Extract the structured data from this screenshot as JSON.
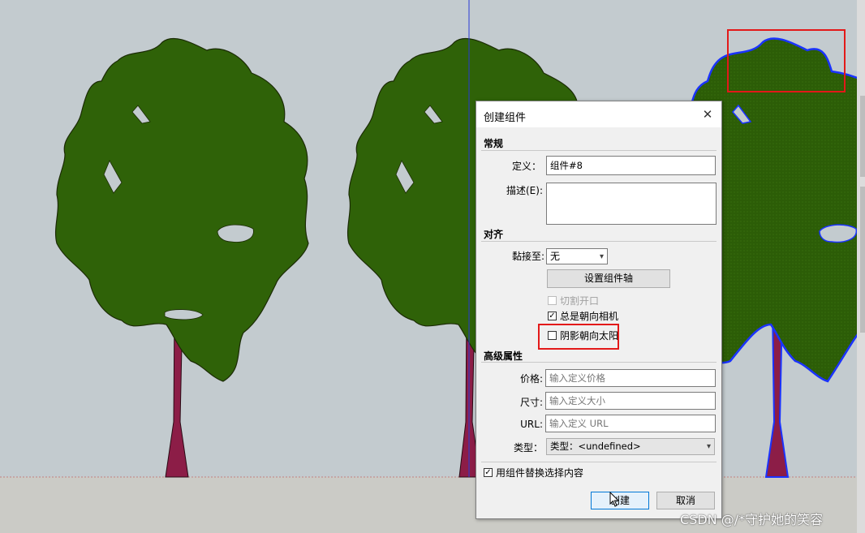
{
  "dialog": {
    "title": "创建组件",
    "close_symbol": "✕",
    "general": {
      "heading": "常规",
      "definition_label": "定义：",
      "definition_value": "组件#8",
      "description_label": "描述(E):",
      "description_value": ""
    },
    "alignment": {
      "heading": "对齐",
      "glue_label": "黏接至:",
      "glue_value": "无",
      "set_axes_button": "设置组件轴",
      "cut_opening_label": "切割开口",
      "cut_opening_checked": false,
      "always_face_camera_label": "总是朝向相机",
      "always_face_camera_checked": true,
      "shadows_face_sun_label": "阴影朝向太阳",
      "shadows_face_sun_checked": false
    },
    "advanced": {
      "heading": "高级属性",
      "price_label": "价格:",
      "price_placeholder": "输入定义价格",
      "size_label": "尺寸:",
      "size_placeholder": "输入定义大小",
      "url_label": "URL:",
      "url_placeholder": "输入定义 URL",
      "type_label": "类型：",
      "type_value": "类型：<undefined>"
    },
    "replace_selection_label": "用组件替换选择内容",
    "replace_selection_checked": true,
    "create_button": "创建",
    "cancel_button": "取消"
  },
  "watermark": "CSDN @/*守护她的笑容",
  "colors": {
    "sky": "#c3cbcf",
    "ground": "#cbcbc6",
    "foliage": "#2f6208",
    "trunk": "#8c1d47",
    "selection_blue": "#1a33ff",
    "axis_blue": "#2a3ad6",
    "highlight_red": "#e31919"
  }
}
